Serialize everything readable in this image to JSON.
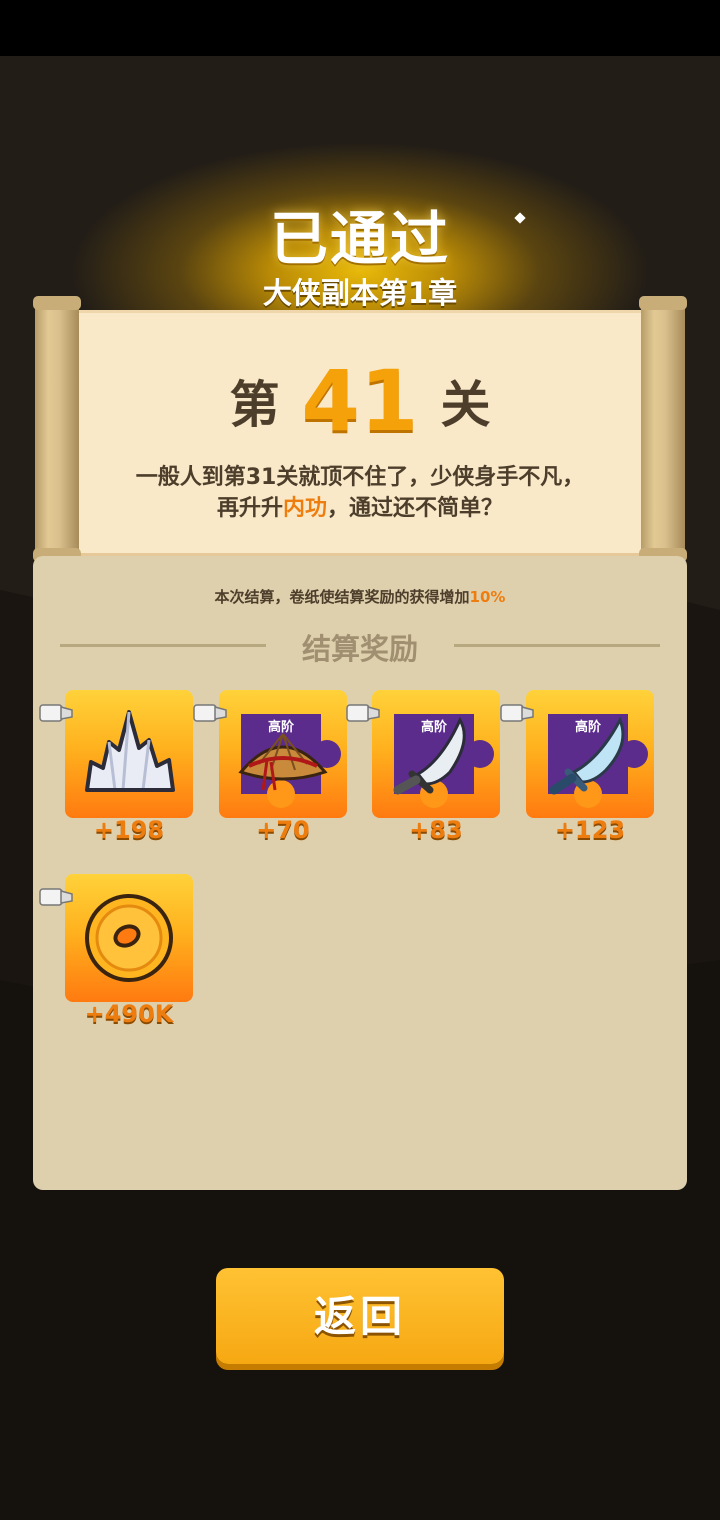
{
  "result": {
    "title": "已通过",
    "subtitle": "大侠副本第1章"
  },
  "level": {
    "prefix": "第",
    "number": "41",
    "suffix": "关",
    "desc_line1": "一般人到第31关就顶不住了，少侠身手不凡，",
    "desc_line2_pre": "再升升",
    "desc_line2_highlight": "内功",
    "desc_line2_post": "，通过还不简单？"
  },
  "bonus": {
    "text_pre": "本次结算，卷纸使结算奖励的获得增加",
    "percent": "10%"
  },
  "rewards": {
    "section_title": "结算奖励",
    "items": [
      {
        "icon": "crystal-icon",
        "grade": "",
        "count": "+198"
      },
      {
        "icon": "straw-hat-fragment-icon",
        "grade": "高阶",
        "count": "+70"
      },
      {
        "icon": "broadsword-fragment-icon",
        "grade": "高阶",
        "count": "+83"
      },
      {
        "icon": "saber-fragment-icon",
        "grade": "高阶",
        "count": "+123"
      },
      {
        "icon": "gold-coin-icon",
        "grade": "",
        "count": "+490K"
      }
    ]
  },
  "actions": {
    "back_label": "返回"
  },
  "colors": {
    "accent_orange": "#ee7d10",
    "button_yellow": "#f6a812",
    "fragment_purple": "#5b2c8c"
  }
}
